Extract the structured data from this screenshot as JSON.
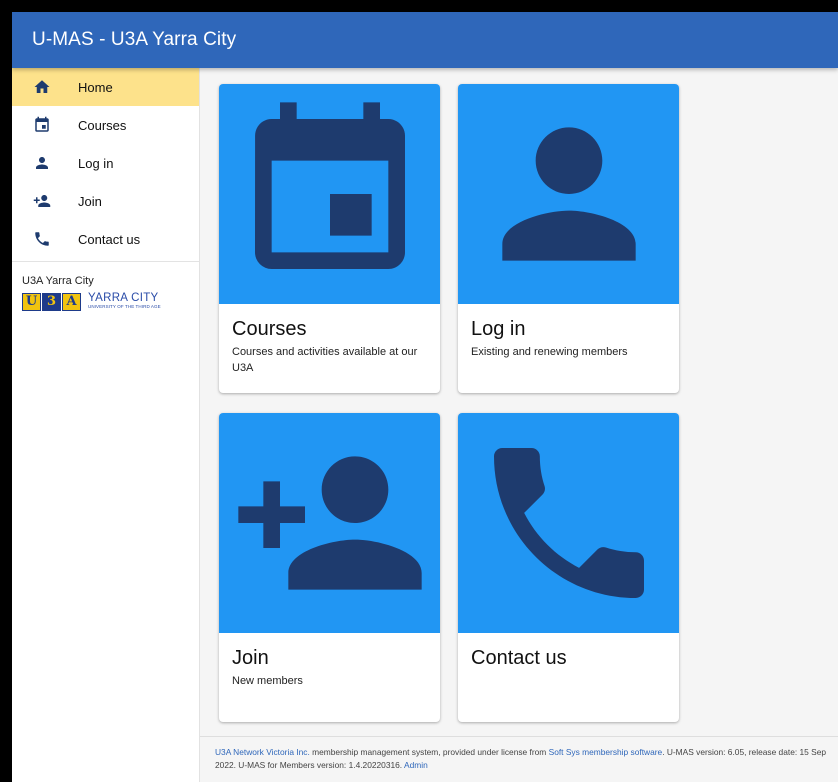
{
  "app": {
    "title": "U-MAS - U3A Yarra City"
  },
  "sidebar": {
    "items": [
      {
        "label": "Home",
        "icon": "home-icon",
        "active": true
      },
      {
        "label": "Courses",
        "icon": "calendar-icon"
      },
      {
        "label": "Log in",
        "icon": "person-icon"
      },
      {
        "label": "Join",
        "icon": "person-add-icon"
      },
      {
        "label": "Contact us",
        "icon": "phone-icon"
      }
    ],
    "org_name": "U3A Yarra City",
    "logo": {
      "letters": [
        "U",
        "3",
        "A"
      ],
      "main": "YARRA CITY",
      "sub": "UNIVERSITY OF THE THIRD AGE"
    }
  },
  "cards": [
    {
      "title": "Courses",
      "description": "Courses and activities available at our U3A",
      "icon": "calendar-icon"
    },
    {
      "title": "Log in",
      "description": "Existing and renewing members",
      "icon": "person-icon"
    },
    {
      "title": "Join",
      "description": "New members",
      "icon": "person-add-icon"
    },
    {
      "title": "Contact us",
      "description": "",
      "icon": "phone-icon"
    }
  ],
  "footer": {
    "org_link": "U3A Network Victoria Inc.",
    "text1": " membership management system, provided under license from ",
    "vendor_link": "Soft Sys membership software",
    "text2": ". U-MAS version: 6.05, release date: 15 Sep 2022. U-MAS for Members version: 1.4.20220316. ",
    "admin_link": "Admin"
  },
  "colors": {
    "appbar": "#2f67ba",
    "active_nav": "#fde28b",
    "card_media": "#2196f3",
    "icon": "#1e3b6e"
  }
}
